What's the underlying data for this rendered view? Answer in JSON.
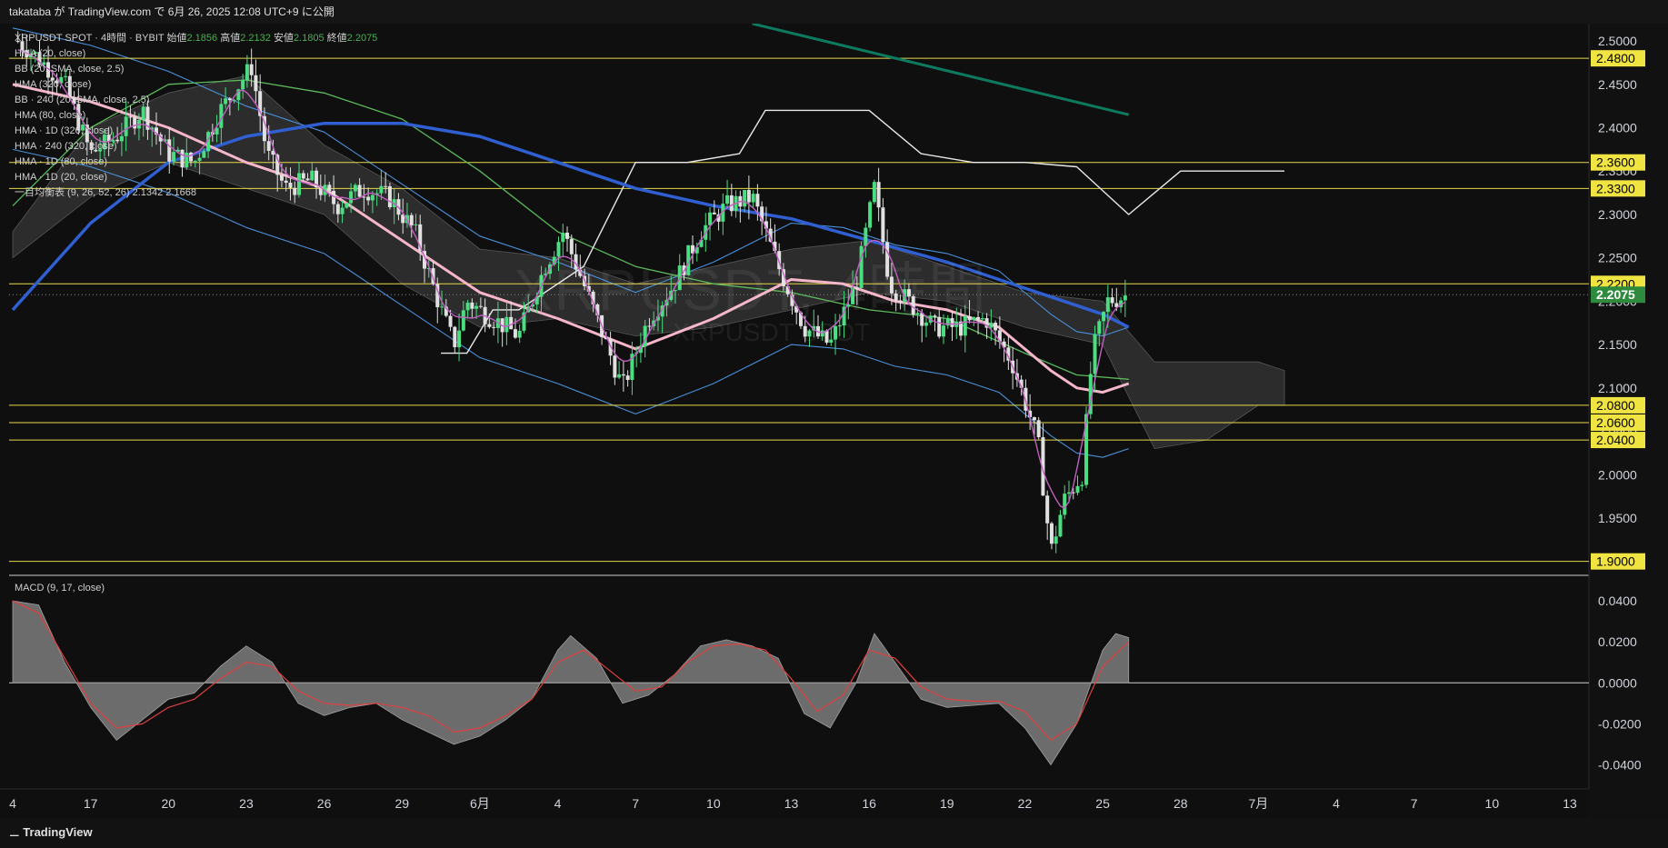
{
  "header": {
    "text": "takataba が TradingView.com で 6月 26, 2025 12:08 UTC+9 に公開"
  },
  "legend": {
    "symbol": "XRPUSDT SPOT · 4時間 · BYBIT",
    "ohlc": [
      {
        "label": "始値",
        "value": "2.1856"
      },
      {
        "label": "高値",
        "value": "2.2132"
      },
      {
        "label": "安値",
        "value": "2.1805"
      },
      {
        "label": "終値",
        "value": "2.2075"
      }
    ],
    "indicators": [
      "HMA (20, close)",
      "BB (20, SMA, close, 2.5)",
      "HMA (320, close)",
      "BB · 240 (20, SMA, close, 2.5)",
      "HMA (80, close)",
      "HMA · 1D (320, close)",
      "HMA · 240 (320, close)",
      "HMA · 1D (80, close)",
      "HMA · 1D (20, close)",
      "一目均衡表 (9, 26, 52, 26)  2.1342  2.1668"
    ],
    "macd_label": "MACD (9, 17, close)"
  },
  "watermark": {
    "title": "XRPUSDT, 4時間",
    "subtitle": "XRPUSDT SPOT"
  },
  "footer": {
    "logo": "TradingView"
  },
  "colors": {
    "bg": "#0f0f0f",
    "up": "#4ade80",
    "down": "#e0e0e0",
    "hline": "#e6d84a",
    "hma320": "#2f5fd0",
    "hma80": "#f4b6c8",
    "hma20": "#c060c0",
    "bb": "#4a90d9",
    "green_ma": "#5cb85c",
    "white_line": "#e8e8e8",
    "teal_line": "#0d7a5f",
    "price_tag": "#2e8b3e",
    "macd_hist": "#8a8a8a",
    "macd_signal": "#e04040"
  },
  "chart_data": {
    "type": "candlestick",
    "symbol": "XRPUSDT",
    "timeframe": "4時間",
    "price_axis": {
      "ylim": [
        1.885,
        2.52
      ],
      "ticks": [
        "2.5000",
        "2.4500",
        "2.4000",
        "2.3500",
        "2.3000",
        "2.2500",
        "2.2000",
        "2.1500",
        "2.1000",
        "2.0500",
        "2.0000",
        "1.9500"
      ]
    },
    "horizontal_levels": [
      {
        "value": 2.48,
        "label": "2.4800"
      },
      {
        "value": 2.36,
        "label": "2.3600"
      },
      {
        "value": 2.33,
        "label": "2.3300"
      },
      {
        "value": 2.22,
        "label": "2.2200"
      },
      {
        "value": 2.08,
        "label": "2.0800"
      },
      {
        "value": 2.06,
        "label": "2.0600"
      },
      {
        "value": 2.04,
        "label": "2.0400"
      },
      {
        "value": 1.9,
        "label": "1.9000"
      }
    ],
    "last_price": {
      "value": 2.2075,
      "label": "2.2075"
    },
    "time_axis": {
      "labels": [
        {
          "label": "4",
          "day": 14
        },
        {
          "label": "17",
          "day": 17
        },
        {
          "label": "20",
          "day": 20
        },
        {
          "label": "23",
          "day": 23
        },
        {
          "label": "26",
          "day": 26
        },
        {
          "label": "29",
          "day": 29
        },
        {
          "label": "6月",
          "day": 32
        },
        {
          "label": "4",
          "day": 35
        },
        {
          "label": "7",
          "day": 38
        },
        {
          "label": "10",
          "day": 41
        },
        {
          "label": "13",
          "day": 44
        },
        {
          "label": "16",
          "day": 47
        },
        {
          "label": "19",
          "day": 50
        },
        {
          "label": "22",
          "day": 53
        },
        {
          "label": "25",
          "day": 56
        },
        {
          "label": "28",
          "day": 59
        },
        {
          "label": "7月",
          "day": 62
        },
        {
          "label": "4",
          "day": 65
        },
        {
          "label": "7",
          "day": 68
        },
        {
          "label": "10",
          "day": 71
        },
        {
          "label": "13",
          "day": 74
        }
      ]
    },
    "price_path": [
      [
        14.2,
        2.5
      ],
      [
        15,
        2.48
      ],
      [
        16,
        2.45
      ],
      [
        17,
        2.37
      ],
      [
        18,
        2.39
      ],
      [
        19,
        2.42
      ],
      [
        20,
        2.37
      ],
      [
        21,
        2.36
      ],
      [
        22,
        2.42
      ],
      [
        23.2,
        2.47
      ],
      [
        23.8,
        2.37
      ],
      [
        24.5,
        2.33
      ],
      [
        25.5,
        2.34
      ],
      [
        26.5,
        2.31
      ],
      [
        27.5,
        2.33
      ],
      [
        28.5,
        2.32
      ],
      [
        29.5,
        2.28
      ],
      [
        30.5,
        2.19
      ],
      [
        31,
        2.15
      ],
      [
        31.5,
        2.2
      ],
      [
        32.5,
        2.18
      ],
      [
        33.5,
        2.16
      ],
      [
        34.5,
        2.24
      ],
      [
        35.2,
        2.28
      ],
      [
        36,
        2.22
      ],
      [
        37,
        2.14
      ],
      [
        37.5,
        2.1
      ],
      [
        38.5,
        2.18
      ],
      [
        39.5,
        2.22
      ],
      [
        40.5,
        2.28
      ],
      [
        41.5,
        2.31
      ],
      [
        42.5,
        2.32
      ],
      [
        43.5,
        2.24
      ],
      [
        44.5,
        2.17
      ],
      [
        45.5,
        2.15
      ],
      [
        46.5,
        2.22
      ],
      [
        47.2,
        2.33
      ],
      [
        47.8,
        2.22
      ],
      [
        48.5,
        2.2
      ],
      [
        49.5,
        2.17
      ],
      [
        50.5,
        2.17
      ],
      [
        51.5,
        2.18
      ],
      [
        52.5,
        2.13
      ],
      [
        53.5,
        2.04
      ],
      [
        54,
        1.91
      ],
      [
        54.5,
        1.97
      ],
      [
        55.2,
        2.0
      ],
      [
        55.6,
        2.14
      ],
      [
        56.2,
        2.2
      ],
      [
        57,
        2.2075
      ]
    ],
    "hma320": [
      [
        14,
        2.19
      ],
      [
        17,
        2.29
      ],
      [
        20,
        2.36
      ],
      [
        23,
        2.39
      ],
      [
        26,
        2.405
      ],
      [
        29,
        2.405
      ],
      [
        32,
        2.39
      ],
      [
        35,
        2.36
      ],
      [
        38,
        2.33
      ],
      [
        41,
        2.31
      ],
      [
        44,
        2.295
      ],
      [
        47,
        2.27
      ],
      [
        50,
        2.245
      ],
      [
        53,
        2.215
      ],
      [
        56,
        2.185
      ],
      [
        57,
        2.17
      ]
    ],
    "hma80": [
      [
        14,
        2.45
      ],
      [
        17,
        2.43
      ],
      [
        20,
        2.4
      ],
      [
        23,
        2.36
      ],
      [
        26,
        2.33
      ],
      [
        29,
        2.27
      ],
      [
        32,
        2.21
      ],
      [
        35,
        2.18
      ],
      [
        38,
        2.145
      ],
      [
        41,
        2.18
      ],
      [
        44,
        2.225
      ],
      [
        46,
        2.22
      ],
      [
        48,
        2.2
      ],
      [
        50,
        2.19
      ],
      [
        52,
        2.17
      ],
      [
        54,
        2.12
      ],
      [
        55,
        2.1
      ],
      [
        56,
        2.095
      ],
      [
        57,
        2.105
      ]
    ],
    "green_ma": [
      [
        14,
        2.31
      ],
      [
        17,
        2.4
      ],
      [
        20,
        2.45
      ],
      [
        23,
        2.455
      ],
      [
        26,
        2.44
      ],
      [
        29,
        2.41
      ],
      [
        32,
        2.35
      ],
      [
        35,
        2.28
      ],
      [
        38,
        2.24
      ],
      [
        41,
        2.22
      ],
      [
        44,
        2.21
      ],
      [
        47,
        2.19
      ],
      [
        50,
        2.18
      ],
      [
        53,
        2.14
      ],
      [
        55,
        2.115
      ],
      [
        57,
        2.11
      ]
    ],
    "white_line": [
      [
        30.5,
        2.14
      ],
      [
        31.5,
        2.14
      ],
      [
        32.5,
        2.19
      ],
      [
        33.5,
        2.19
      ],
      [
        36,
        2.24
      ],
      [
        38,
        2.36
      ],
      [
        40,
        2.36
      ],
      [
        42,
        2.37
      ],
      [
        43,
        2.42
      ],
      [
        45,
        2.42
      ],
      [
        47,
        2.42
      ],
      [
        49,
        2.37
      ],
      [
        51,
        2.36
      ],
      [
        53,
        2.36
      ],
      [
        55,
        2.355
      ],
      [
        57,
        2.3
      ],
      [
        59,
        2.35
      ],
      [
        63,
        2.35
      ]
    ],
    "teal_line": [
      [
        42.5,
        2.52
      ],
      [
        57,
        2.415
      ]
    ],
    "ichimoku_cloud": [
      [
        14,
        2.25,
        2.28
      ],
      [
        17,
        2.32,
        2.4
      ],
      [
        20,
        2.36,
        2.44
      ],
      [
        23,
        2.33,
        2.46
      ],
      [
        26,
        2.3,
        2.38
      ],
      [
        29,
        2.22,
        2.33
      ],
      [
        32,
        2.17,
        2.26
      ],
      [
        35,
        2.18,
        2.25
      ],
      [
        38,
        2.16,
        2.22
      ],
      [
        41,
        2.17,
        2.24
      ],
      [
        44,
        2.19,
        2.26
      ],
      [
        47,
        2.21,
        2.27
      ],
      [
        50,
        2.2,
        2.24
      ],
      [
        53,
        2.17,
        2.21
      ],
      [
        56,
        2.15,
        2.2
      ],
      [
        58,
        2.03,
        2.13
      ],
      [
        60,
        2.04,
        2.13
      ],
      [
        62,
        2.08,
        2.13
      ],
      [
        63,
        2.08,
        2.12
      ]
    ],
    "macd": {
      "label": "MACD (9, 17, close)",
      "ylim": [
        -0.05,
        0.052
      ],
      "ticks": [
        "0.0400",
        "0.0200",
        "0.0000",
        "-0.0200",
        "-0.0400"
      ],
      "histogram": [
        [
          14,
          0.04
        ],
        [
          15,
          0.038
        ],
        [
          16,
          0.01
        ],
        [
          17,
          -0.012
        ],
        [
          18,
          -0.028
        ],
        [
          19,
          -0.018
        ],
        [
          20,
          -0.008
        ],
        [
          21,
          -0.005
        ],
        [
          22,
          0.008
        ],
        [
          23,
          0.018
        ],
        [
          24,
          0.01
        ],
        [
          25,
          -0.01
        ],
        [
          26,
          -0.016
        ],
        [
          27,
          -0.012
        ],
        [
          28,
          -0.01
        ],
        [
          29,
          -0.018
        ],
        [
          30,
          -0.024
        ],
        [
          31,
          -0.03
        ],
        [
          32,
          -0.026
        ],
        [
          33,
          -0.018
        ],
        [
          34,
          -0.008
        ],
        [
          35,
          0.016
        ],
        [
          35.5,
          0.023
        ],
        [
          36.5,
          0.012
        ],
        [
          37.5,
          -0.01
        ],
        [
          38.5,
          -0.006
        ],
        [
          39.5,
          0.004
        ],
        [
          40.5,
          0.018
        ],
        [
          41.5,
          0.021
        ],
        [
          42.5,
          0.018
        ],
        [
          43.5,
          0.012
        ],
        [
          44.5,
          -0.015
        ],
        [
          45.5,
          -0.022
        ],
        [
          46.5,
          0.0
        ],
        [
          47.2,
          0.024
        ],
        [
          48,
          0.01
        ],
        [
          49,
          -0.008
        ],
        [
          50,
          -0.012
        ],
        [
          51,
          -0.011
        ],
        [
          52,
          -0.01
        ],
        [
          53,
          -0.022
        ],
        [
          54,
          -0.04
        ],
        [
          55,
          -0.02
        ],
        [
          56,
          0.016
        ],
        [
          56.5,
          0.024
        ],
        [
          57,
          0.022
        ]
      ],
      "signal": [
        [
          14,
          0.04
        ],
        [
          15,
          0.034
        ],
        [
          16,
          0.012
        ],
        [
          17,
          -0.01
        ],
        [
          18,
          -0.022
        ],
        [
          19,
          -0.02
        ],
        [
          20,
          -0.012
        ],
        [
          21,
          -0.008
        ],
        [
          22,
          0.002
        ],
        [
          23,
          0.01
        ],
        [
          24,
          0.008
        ],
        [
          25,
          -0.004
        ],
        [
          26,
          -0.01
        ],
        [
          27,
          -0.011
        ],
        [
          28,
          -0.01
        ],
        [
          29,
          -0.012
        ],
        [
          30,
          -0.016
        ],
        [
          31,
          -0.024
        ],
        [
          32,
          -0.022
        ],
        [
          33,
          -0.016
        ],
        [
          34,
          -0.008
        ],
        [
          35,
          0.01
        ],
        [
          36,
          0.016
        ],
        [
          37,
          0.006
        ],
        [
          38,
          -0.004
        ],
        [
          39,
          -0.002
        ],
        [
          40,
          0.01
        ],
        [
          41,
          0.018
        ],
        [
          42,
          0.019
        ],
        [
          43,
          0.016
        ],
        [
          44,
          0.002
        ],
        [
          45,
          -0.014
        ],
        [
          46,
          -0.006
        ],
        [
          47,
          0.016
        ],
        [
          48,
          0.012
        ],
        [
          49,
          -0.002
        ],
        [
          50,
          -0.008
        ],
        [
          51,
          -0.009
        ],
        [
          52,
          -0.009
        ],
        [
          53,
          -0.014
        ],
        [
          54,
          -0.028
        ],
        [
          55,
          -0.02
        ],
        [
          56,
          0.008
        ],
        [
          57,
          0.02
        ]
      ]
    }
  }
}
